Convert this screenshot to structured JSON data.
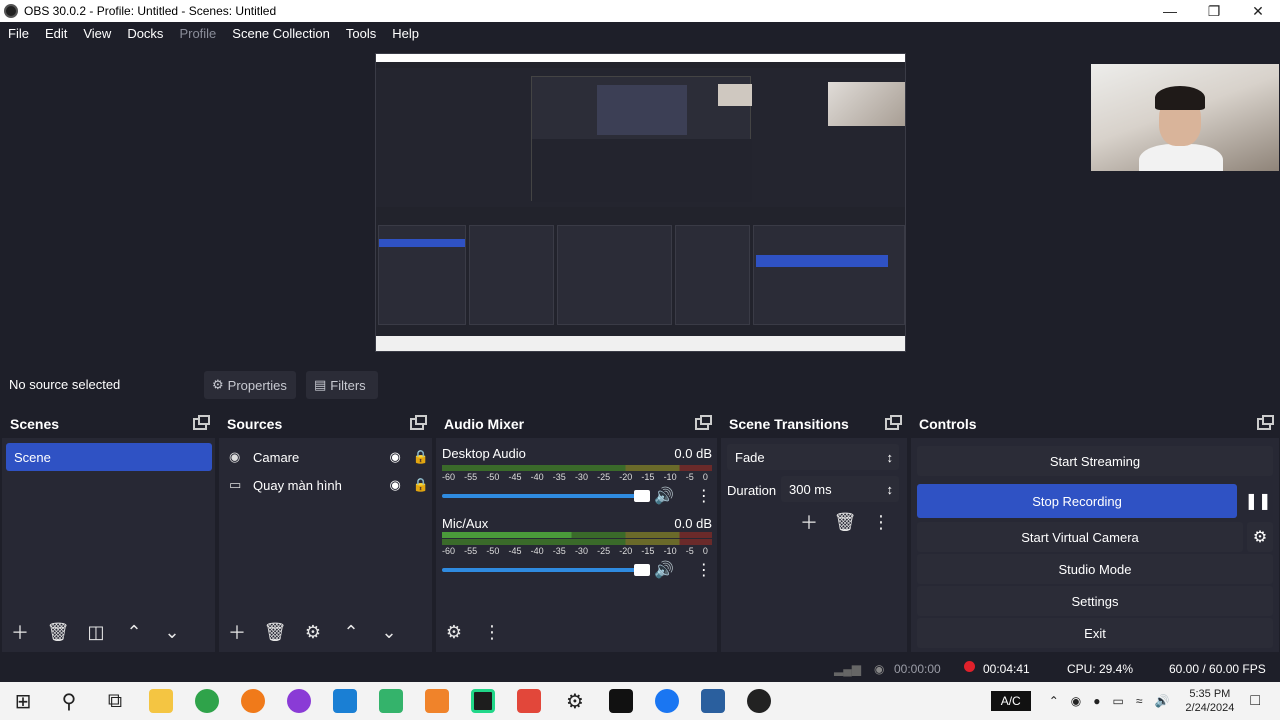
{
  "window": {
    "title": "OBS 30.0.2 - Profile: Untitled - Scenes: Untitled"
  },
  "menu": [
    "File",
    "Edit",
    "View",
    "Docks",
    "Profile",
    "Scene Collection",
    "Tools",
    "Help"
  ],
  "source_bar": {
    "status": "No source selected",
    "properties": "Properties",
    "filters": "Filters"
  },
  "scenes": {
    "title": "Scenes",
    "items": [
      "Scene"
    ]
  },
  "sources": {
    "title": "Sources",
    "items": [
      "Camare",
      "Quay màn hình"
    ]
  },
  "mixer": {
    "title": "Audio Mixer",
    "channels": [
      {
        "name": "Desktop Audio",
        "level": "0.0 dB"
      },
      {
        "name": "Mic/Aux",
        "level": "0.0 dB"
      }
    ],
    "ticks": [
      "-60",
      "-55",
      "-50",
      "-45",
      "-40",
      "-35",
      "-30",
      "-25",
      "-20",
      "-15",
      "-10",
      "-5",
      "0"
    ]
  },
  "transitions": {
    "title": "Scene Transitions",
    "selected": "Fade",
    "duration_label": "Duration",
    "duration": "300 ms"
  },
  "controls": {
    "title": "Controls",
    "start_streaming": "Start Streaming",
    "stop_recording": "Stop Recording",
    "start_virtual_camera": "Start Virtual Camera",
    "studio_mode": "Studio Mode",
    "settings": "Settings",
    "exit": "Exit"
  },
  "status": {
    "stream_time": "00:00:00",
    "rec_time": "00:04:41",
    "cpu": "CPU: 29.4%",
    "fps": "60.00 / 60.00 FPS"
  },
  "taskbar": {
    "input": "A/C",
    "time": "5:35 PM",
    "date": "2/24/2024"
  },
  "colors": {
    "accent": "#2f52c4",
    "dock_bg": "#272834",
    "window_bg": "#1e1f29",
    "rec_dot": "#e0212b"
  }
}
